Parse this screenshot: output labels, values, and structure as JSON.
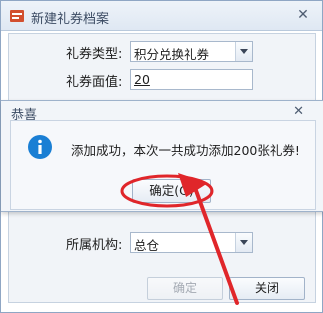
{
  "window": {
    "title": "新建礼券档案",
    "close_glyph": "✕"
  },
  "form": {
    "coupon_type_label": "礼券类型:",
    "coupon_type_value": "积分兑换礼券",
    "face_value_label": "礼券面值:",
    "face_value_value": "20",
    "org_label": "所属机构:",
    "org_value": "总仓",
    "confirm_label": "确定",
    "close_label": "关闭"
  },
  "dialog": {
    "title": "恭喜",
    "close_glyph": "✕",
    "message": "添加成功，本次一共成功添加200张礼券!",
    "ok_label": "确定(O)"
  },
  "icons": {
    "app": "app-icon",
    "info": "info-icon",
    "dropdown": "chevron-down-icon"
  },
  "colors": {
    "annotation_red": "#e0262a",
    "info_blue": "#1a7fd4"
  }
}
